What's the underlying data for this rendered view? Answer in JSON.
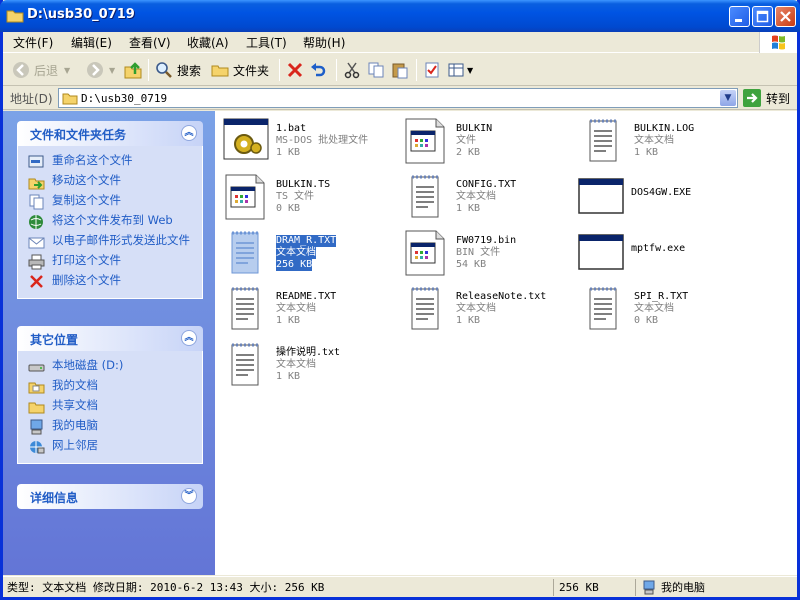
{
  "window": {
    "title": "D:\\usb30_0719"
  },
  "menu": [
    "文件(F)",
    "编辑(E)",
    "查看(V)",
    "收藏(A)",
    "工具(T)",
    "帮助(H)"
  ],
  "toolbar": {
    "back": "后退",
    "search": "搜索",
    "folders": "文件夹"
  },
  "address": {
    "label": "地址(D)",
    "value": "D:\\usb30_0719",
    "go": "转到"
  },
  "tasks_panel": {
    "title": "文件和文件夹任务",
    "items": [
      "重命名这个文件",
      "移动这个文件",
      "复制这个文件",
      "将这个文件发布到 Web",
      "以电子邮件形式发送此文件",
      "打印这个文件",
      "删除这个文件"
    ]
  },
  "places_panel": {
    "title": "其它位置",
    "items": [
      "本地磁盘 (D:)",
      "我的文档",
      "共享文档",
      "我的电脑",
      "网上邻居"
    ]
  },
  "details_panel": {
    "title": "详细信息"
  },
  "files": [
    {
      "name": "1.bat",
      "type": "MS-DOS 批处理文件",
      "size": "1 KB",
      "icon": "batch-file-icon"
    },
    {
      "name": "BULKIN",
      "type": "文件",
      "size": "2 KB",
      "icon": "generic-file-icon"
    },
    {
      "name": "BULKIN.LOG",
      "type": "文本文档",
      "size": "1 KB",
      "icon": "text-file-icon"
    },
    {
      "name": "BULKIN.TS",
      "type": "TS 文件",
      "size": "0 KB",
      "icon": "generic-file-icon"
    },
    {
      "name": "CONFIG.TXT",
      "type": "文本文档",
      "size": "1 KB",
      "icon": "text-file-icon"
    },
    {
      "name": "DOS4GW.EXE",
      "type": "",
      "size": "",
      "icon": "executable-icon"
    },
    {
      "name": "DRAM_R.TXT",
      "type": "文本文档",
      "size": "256 KB",
      "icon": "text-file-icon",
      "selected": true
    },
    {
      "name": "FW0719.bin",
      "type": "BIN 文件",
      "size": "54 KB",
      "icon": "generic-file-icon"
    },
    {
      "name": "mptfw.exe",
      "type": "",
      "size": "",
      "icon": "executable-icon"
    },
    {
      "name": "README.TXT",
      "type": "文本文档",
      "size": "1 KB",
      "icon": "text-file-icon"
    },
    {
      "name": "ReleaseNote.txt",
      "type": "文本文档",
      "size": "1 KB",
      "icon": "text-file-icon"
    },
    {
      "name": "SPI_R.TXT",
      "type": "文本文档",
      "size": "0 KB",
      "icon": "text-file-icon"
    },
    {
      "name": "操作说明.txt",
      "type": "文本文档",
      "size": "1 KB",
      "icon": "text-file-icon"
    }
  ],
  "status": {
    "info": "类型: 文本文档 修改日期: 2010-6-2 13:43 大小: 256 KB",
    "size": "256 KB",
    "location": "我的电脑"
  }
}
